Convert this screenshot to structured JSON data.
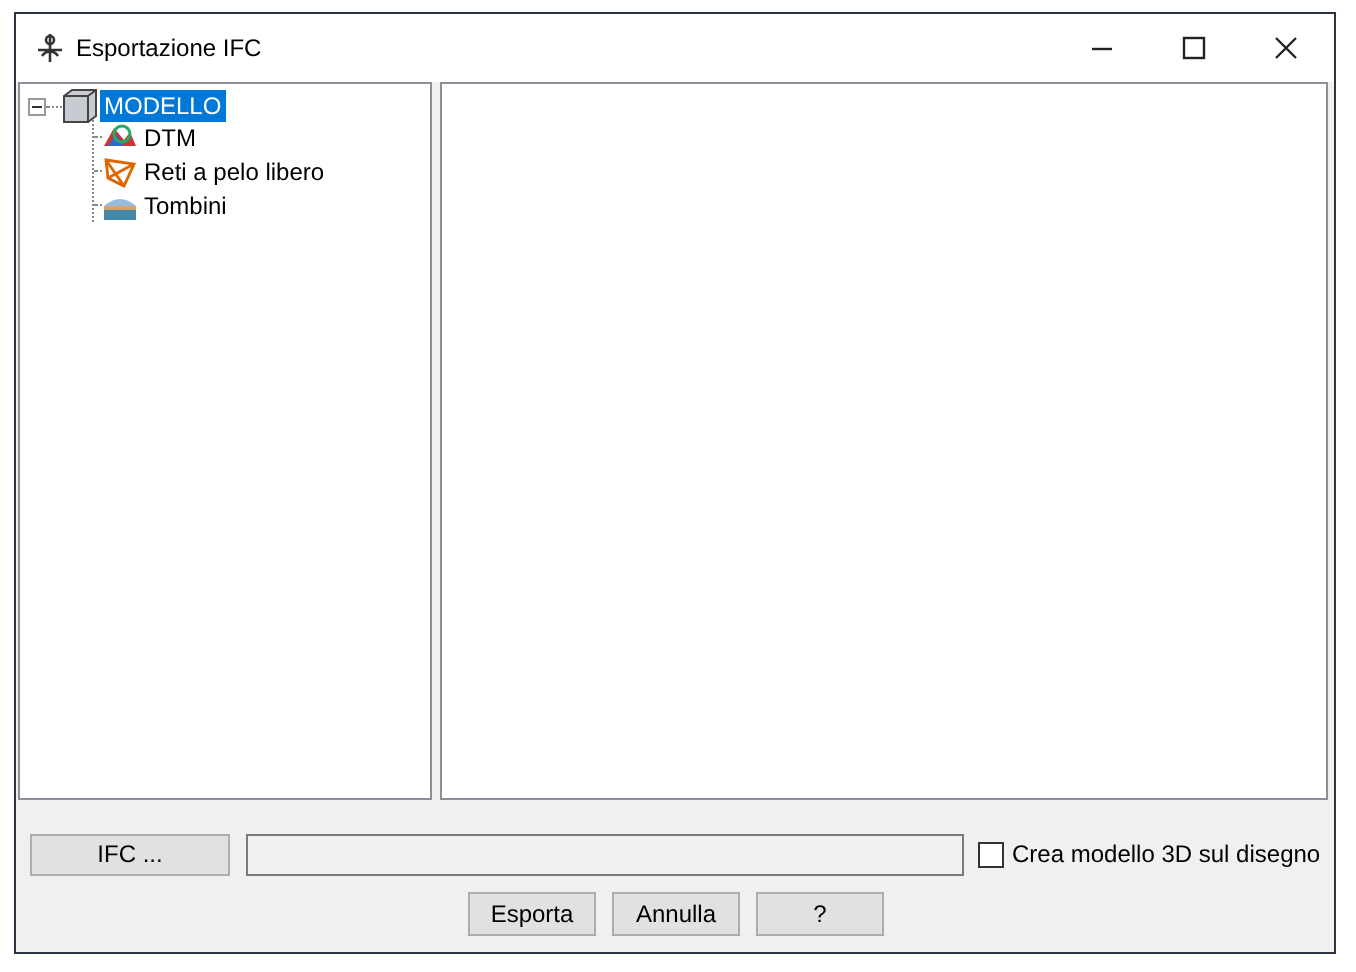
{
  "window": {
    "title": "Esportazione IFC"
  },
  "tree": [
    {
      "label": "MODELLO",
      "selected": true,
      "expanded": true,
      "children": [
        {
          "label": "DTM",
          "selected": false
        },
        {
          "label": "Reti a pelo libero",
          "selected": false
        },
        {
          "label": "Tombini",
          "selected": false
        }
      ]
    }
  ],
  "file_button": "IFC ...",
  "option": {
    "label": "Crea modello 3D sul disegno",
    "checked": false
  },
  "buttons": [
    "Esporta",
    "Annulla",
    "?"
  ]
}
